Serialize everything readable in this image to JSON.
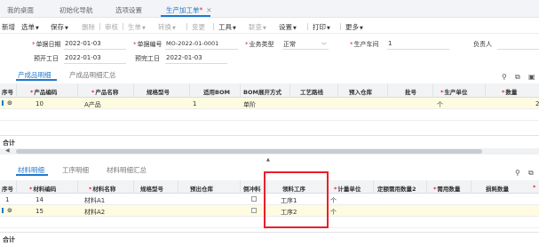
{
  "tabs": [
    {
      "label": "我的桌面"
    },
    {
      "label": "初始化导航"
    },
    {
      "label": "选项设置"
    },
    {
      "label": "生产加工单",
      "modified": "*"
    }
  ],
  "toolbar": {
    "items": [
      "新增",
      "选单",
      "保存",
      "删除",
      "审核",
      "生单",
      "转换",
      "变更",
      "工具",
      "联查",
      "设置",
      "打印",
      "更多"
    ]
  },
  "form": {
    "doc_date_label": "单据日期",
    "doc_date": "2022-01-03",
    "doc_no_label": "单据编号",
    "doc_no": "MO-2022-01-0001",
    "biz_type_label": "业务类型",
    "biz_type": "正常",
    "workshop_label": "生产车间",
    "workshop": "1",
    "owner_label": "负责人",
    "plan_start_label": "预开工日",
    "plan_start": "2022-01-03",
    "plan_end_label": "预完工日",
    "plan_end": "2022-01-03"
  },
  "product_tabs": [
    "产成品明细",
    "产成品明细汇总"
  ],
  "product_grid": {
    "headers": [
      "序号",
      "产品编码",
      "产品名称",
      "规格型号",
      "适用BOM",
      "BOM展开方式",
      "工艺路线",
      "预入仓库",
      "批号",
      "生产单位",
      "数量"
    ],
    "rows": [
      {
        "no": "10",
        "code": "",
        "name": "A产品",
        "spec": "",
        "bom": "1",
        "expand": "单阶",
        "route": "",
        "wh": "",
        "batch": "",
        "unit": "个",
        "qty": ""
      }
    ],
    "total_label": "合计"
  },
  "material_tabs": [
    "材料明细",
    "工序明细",
    "材料明细汇总"
  ],
  "material_grid": {
    "headers": [
      "序号",
      "材料编码",
      "材料名称",
      "规格型号",
      "预出仓库",
      "倒冲料",
      "领料工序",
      "计量单位",
      "定额需用数量2",
      "需用数量",
      "损耗数量"
    ],
    "rows": [
      {
        "no": "1",
        "code": "14",
        "name": "材料A1",
        "process": "工序1",
        "unit": "个"
      },
      {
        "no": "2",
        "code": "15",
        "name": "材料A2",
        "process": "工序2",
        "unit": "个"
      }
    ],
    "total_label": "合计"
  },
  "colors": {
    "accent": "#1f78d1",
    "highlight_box": "#e8202a",
    "selected_row": "#fffbe0"
  }
}
